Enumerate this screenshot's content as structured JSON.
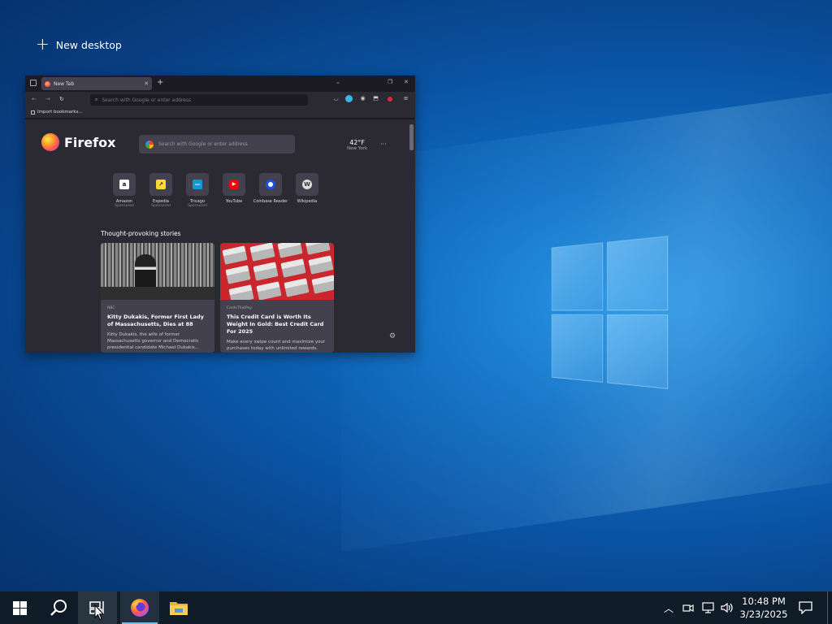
{
  "task_view": {
    "new_desktop_label": "New desktop"
  },
  "firefox_window": {
    "tab_title": "New Tab",
    "url_placeholder": "Search with Google or enter address",
    "bookmark_label": "Import bookmarks...",
    "brand": "Firefox",
    "search_placeholder": "Search with Google or enter address",
    "weather": {
      "temp": "42°F",
      "city": "New York"
    },
    "shortcuts": [
      {
        "name": "Amazon",
        "sponsored": "Sponsored",
        "icon": "amazon-icon",
        "color": "#ffffff"
      },
      {
        "name": "Expedia",
        "sponsored": "Sponsored",
        "icon": "expedia-icon",
        "color": "#fddb32"
      },
      {
        "name": "Trivago",
        "sponsored": "Sponsored",
        "icon": "trivago-icon",
        "color": "#0e9bd5"
      },
      {
        "name": "YouTube",
        "sponsored": "",
        "icon": "youtube-icon",
        "color": "#ff0000"
      },
      {
        "name": "Coinbase Reader",
        "sponsored": "",
        "icon": "coinbase-icon",
        "color": "#1652f0"
      },
      {
        "name": "Wikipedia",
        "sponsored": "",
        "icon": "wikipedia-icon",
        "color": "#dddddd"
      }
    ],
    "stories_heading": "Thought-provoking stories",
    "stories": [
      {
        "source": "NBC",
        "title": "Kitty Dukakis, Former First Lady of Massachusetts, Dies at 88",
        "description": "Kitty Dukakis, the wife of former Massachusetts governor and Democratic presidential candidate Michael Dukakis..."
      },
      {
        "source": "CardsThatPay",
        "title": "This Credit Card is Worth Its Weight In Gold: Best Credit Card For 2025",
        "description": "Make every swipe count and maximize your purchases today with unlimited rewards."
      }
    ]
  },
  "taskbar": {
    "clock_time": "10:48 PM",
    "clock_date": "3/23/2025",
    "accent_color": "#76b9ed"
  }
}
